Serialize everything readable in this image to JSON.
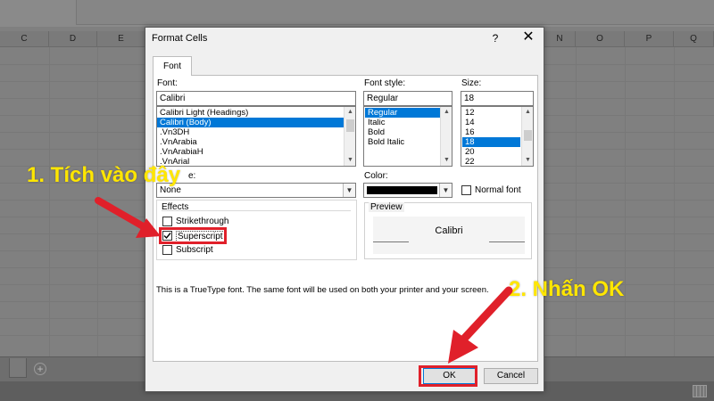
{
  "spreadsheet": {
    "columns_left": [
      "C",
      "D",
      "E"
    ],
    "columns_right": [
      "N",
      "O",
      "P",
      "Q"
    ]
  },
  "dialog": {
    "title": "Format Cells",
    "help": "?",
    "close": "✕",
    "tab": "Font",
    "font": {
      "label": "Font:",
      "value": "Calibri",
      "items": [
        {
          "text": "Calibri Light (Headings)",
          "selected": false
        },
        {
          "text": "Calibri (Body)",
          "selected": true
        },
        {
          "text": ".Vn3DH",
          "selected": false
        },
        {
          "text": ".VnArabia",
          "selected": false
        },
        {
          "text": ".VnArabiaH",
          "selected": false
        },
        {
          "text": ".VnArial",
          "selected": false
        }
      ]
    },
    "font_style": {
      "label": "Font style:",
      "value": "Regular",
      "items": [
        {
          "text": "Regular",
          "selected": true
        },
        {
          "text": "Italic",
          "selected": false
        },
        {
          "text": "Bold",
          "selected": false
        },
        {
          "text": "Bold Italic",
          "selected": false
        }
      ]
    },
    "size": {
      "label": "Size:",
      "value": "18",
      "items": [
        {
          "text": "12",
          "selected": false
        },
        {
          "text": "14",
          "selected": false
        },
        {
          "text": "16",
          "selected": false
        },
        {
          "text": "18",
          "selected": true
        },
        {
          "text": "20",
          "selected": false
        },
        {
          "text": "22",
          "selected": false
        }
      ]
    },
    "underline": {
      "label_partial": "e:",
      "value": "None"
    },
    "color": {
      "label": "Color:",
      "swatch": "#000000"
    },
    "normal_font": {
      "label": "Normal font",
      "checked": false
    },
    "effects": {
      "label": "Effects",
      "strikethrough": {
        "label": "Strikethrough",
        "checked": false
      },
      "superscript": {
        "label": "Superscript",
        "checked": true
      },
      "subscript": {
        "label": "Subscript",
        "checked": false
      }
    },
    "preview": {
      "label": "Preview",
      "text": "Calibri"
    },
    "info": "This is a TrueType font.  The same font will be used on both your printer and your screen.",
    "ok_label": "OK",
    "cancel_label": "Cancel"
  },
  "annotations": {
    "step1": "1. Tích vào đây",
    "step2": "2. Nhấn OK",
    "color": "#ffe600",
    "highlight_color": "#e0202a"
  }
}
